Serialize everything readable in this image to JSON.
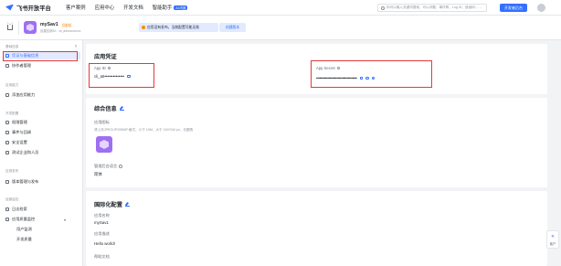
{
  "topbar": {
    "logo_text": "飞书开放平台",
    "nav": [
      "客户案例",
      "应用中心",
      "开发文档",
      "智能助手"
    ],
    "beta_label": "AI 内测",
    "search_placeholder": "你可以输入关键词搜索，可以问题、事件等，Log ID，错误码……",
    "dev_button": "开发者后台"
  },
  "appbar": {
    "app_name": "mySav1",
    "status": "已发布",
    "app_sub": "自建应用ID：cli_a5xxxxxxxxx",
    "notice": "应用没有发布，当前配置可能无效",
    "notice_button": "创建版本"
  },
  "sidebar": {
    "groups": [
      {
        "label": "基础信息",
        "items": [
          {
            "label": "凭证与基础信息",
            "active": true
          },
          {
            "label": "协作者管理",
            "active": false
          }
        ]
      },
      {
        "label": "应用能力",
        "items": [
          {
            "label": "添加应用能力",
            "active": false
          }
        ]
      },
      {
        "label": "开发配置",
        "items": [
          {
            "label": "权限管理",
            "active": false
          },
          {
            "label": "事件与回调",
            "active": false
          },
          {
            "label": "安全设置",
            "active": false
          },
          {
            "label": "测试企业和人员",
            "active": false
          }
        ]
      },
      {
        "label": "应用发布",
        "items": [
          {
            "label": "版本管理与发布",
            "active": false
          }
        ]
      },
      {
        "label": "运营监控",
        "items": [
          {
            "label": "日志检索",
            "active": false
          },
          {
            "label": "应用质量监控",
            "active": false
          },
          {
            "label": "用户监测",
            "active": false,
            "sub": true
          },
          {
            "label": "开发质量",
            "active": false,
            "sub": true
          }
        ]
      }
    ]
  },
  "credentials": {
    "title": "应用凭证",
    "app_id_label": "App ID",
    "app_id_value": "cli_a5••••••••••••••",
    "app_secret_label": "App Secret",
    "app_secret_value": "••••••••••••••••••••••••••••••••••••"
  },
  "general": {
    "title": "综合信息",
    "icon_label": "应用图标",
    "icon_hint": "请上传JPEG/JPG/BMP 格式，小于 10M，大于 240*240 px，无圆角",
    "lang_label": "管理后台语言",
    "lang_value": "简体"
  },
  "intl": {
    "title": "国际化配置",
    "name_label": "应用名称",
    "name_value": "mySav1",
    "desc_label": "应用描述",
    "desc_value": "Hello world!",
    "help_label": "帮助文档"
  },
  "right_tab": {
    "label": "客户"
  },
  "colors": {
    "accent": "#3370ff",
    "highlight_box": "#e5383b",
    "app_icon": "#9f6ff1"
  }
}
